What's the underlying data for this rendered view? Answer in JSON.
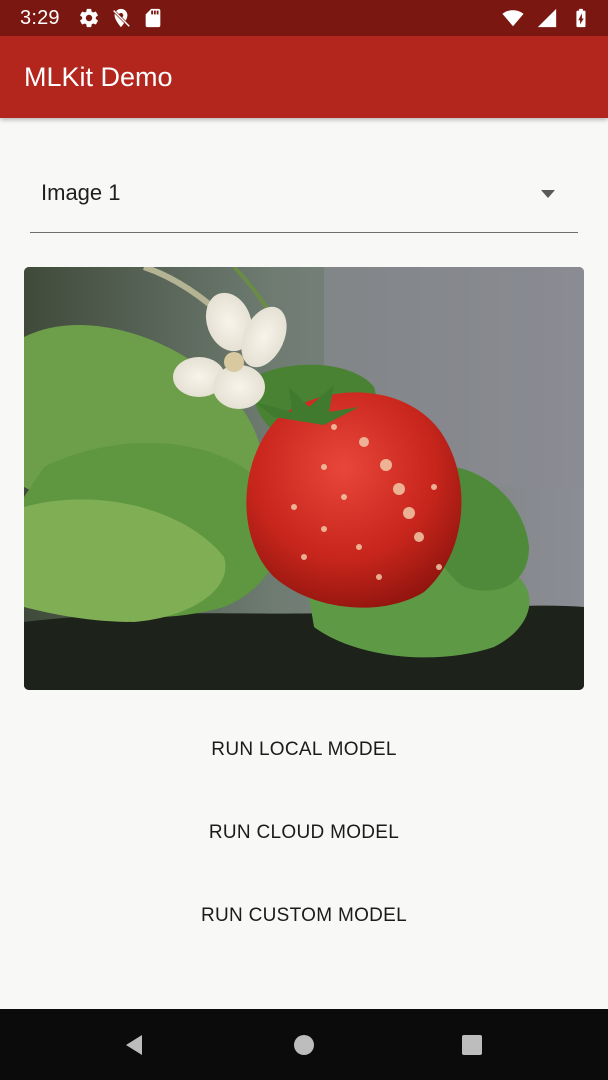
{
  "status_bar": {
    "time": "3:29",
    "left_icons": [
      "settings-icon",
      "location-off-icon",
      "sd-card-icon"
    ],
    "right_icons": [
      "wifi-icon",
      "signal-icon",
      "battery-icon"
    ],
    "background_color": "#7b1711"
  },
  "app_bar": {
    "title": "MLKit Demo",
    "background_color": "#b3261e"
  },
  "dropdown": {
    "selected_value": "Image 1",
    "icon": "dropdown-arrow-icon"
  },
  "image_card": {
    "content": "strawberry-image"
  },
  "buttons": {
    "run_local": "RUN LOCAL MODEL",
    "run_cloud": "RUN CLOUD MODEL",
    "run_custom": "RUN CUSTOM MODEL"
  },
  "nav_bar": {
    "icons": [
      "back-icon",
      "home-icon",
      "recents-icon"
    ]
  }
}
